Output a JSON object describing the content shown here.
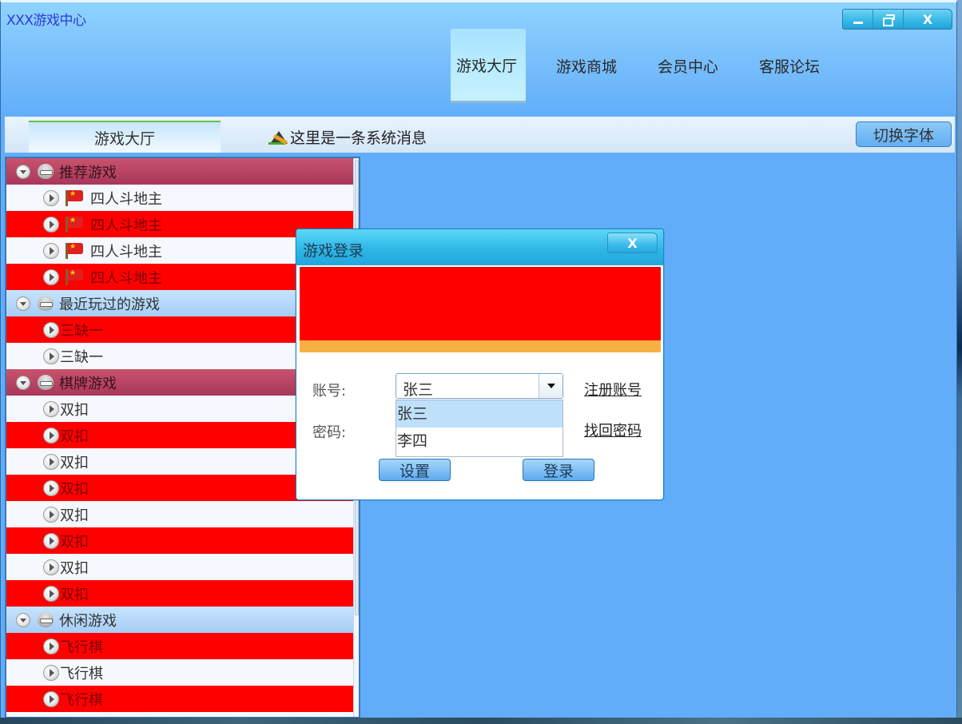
{
  "window": {
    "title": "XXX游戏中心",
    "controls": {
      "minimize": "minimize",
      "restore": "restore",
      "close": "X"
    }
  },
  "nav": {
    "items": [
      {
        "label": "游戏大厅",
        "active": true
      },
      {
        "label": "游戏商城",
        "active": false
      },
      {
        "label": "会员中心",
        "active": false
      },
      {
        "label": "客服论坛",
        "active": false
      }
    ]
  },
  "toolbar": {
    "tab_label": "游戏大厅",
    "system_message": "这里是一条系统消息",
    "switch_font_label": "切换字体"
  },
  "tree": {
    "groups": [
      {
        "label": "推荐游戏",
        "style": "maroon",
        "items": [
          {
            "label": "四人斗地主",
            "highlight": false,
            "flag": true
          },
          {
            "label": "四人斗地主",
            "highlight": true,
            "flag": true
          },
          {
            "label": "四人斗地主",
            "highlight": false,
            "flag": true
          },
          {
            "label": "四人斗地主",
            "highlight": true,
            "flag": true
          }
        ]
      },
      {
        "label": "最近玩过的游戏",
        "style": "blue",
        "items": [
          {
            "label": "三缺一",
            "highlight": true,
            "flag": false
          },
          {
            "label": "三缺一",
            "highlight": false,
            "flag": false
          }
        ]
      },
      {
        "label": "棋牌游戏",
        "style": "maroon",
        "items": [
          {
            "label": "双扣",
            "highlight": false,
            "flag": false
          },
          {
            "label": "双扣",
            "highlight": true,
            "flag": false
          },
          {
            "label": "双扣",
            "highlight": false,
            "flag": false
          },
          {
            "label": "双扣",
            "highlight": true,
            "flag": false
          },
          {
            "label": "双扣",
            "highlight": false,
            "flag": false
          },
          {
            "label": "双扣",
            "highlight": true,
            "flag": false
          },
          {
            "label": "双扣",
            "highlight": false,
            "flag": false
          },
          {
            "label": "双扣",
            "highlight": true,
            "flag": false
          }
        ]
      },
      {
        "label": "休闲游戏",
        "style": "blue",
        "items": [
          {
            "label": "飞行棋",
            "highlight": true,
            "flag": false
          },
          {
            "label": "飞行棋",
            "highlight": false,
            "flag": false
          },
          {
            "label": "飞行棋",
            "highlight": true,
            "flag": false
          }
        ]
      }
    ]
  },
  "login_dialog": {
    "title": "游戏登录",
    "close_label": "X",
    "account_label": "账号:",
    "password_label": "密码:",
    "account_value": "张三",
    "account_options": [
      {
        "label": "张三",
        "selected": true
      },
      {
        "label": "李四",
        "selected": false
      }
    ],
    "register_link": "注册账号",
    "recover_link": "找回密码",
    "settings_button": "设置",
    "login_button": "登录",
    "banner_color": "#ff0000",
    "banner_strip_color": "#f7b042"
  },
  "colors": {
    "background": "#62adf9",
    "highlight_row": "#ff0000",
    "group_maroon": "#b84462",
    "group_blue": "#b6d8fa",
    "title_text": "#2c3bd6"
  }
}
